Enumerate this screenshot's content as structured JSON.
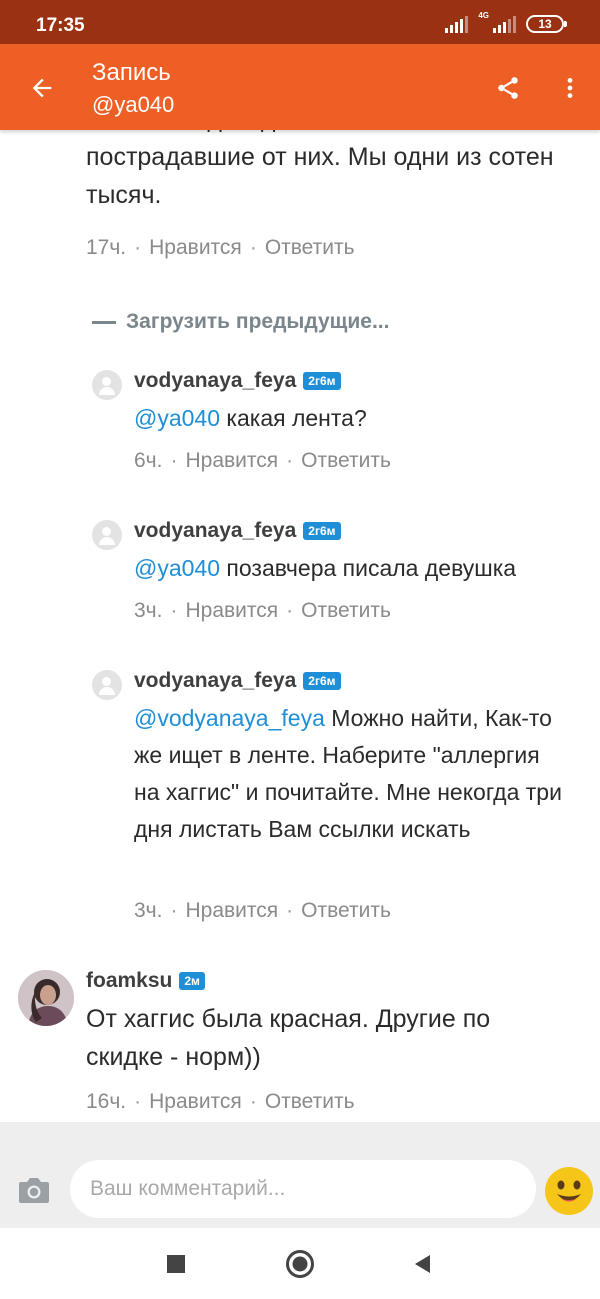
{
  "status_bar": {
    "time": "17:35",
    "network": "4G",
    "battery": "13"
  },
  "app_bar": {
    "title": "Запись",
    "subtitle": "@ya040",
    "accent": "#ee5f25"
  },
  "top_comment": {
    "text_line1": "злит... Каждый день в ленте есть",
    "text_rest": "пострадавшие от них. Мы одни из сотен тысяч.",
    "time": "17ч.",
    "like": "Нравится",
    "reply": "Ответить"
  },
  "load_previous": "Загрузить предыдущие...",
  "replies": [
    {
      "username": "vodyanaya_feya",
      "badge": "2г6м",
      "mention": "@ya040",
      "text": " какая лента?",
      "time": "6ч.",
      "like": "Нравится",
      "reply": "Ответить"
    },
    {
      "username": "vodyanaya_feya",
      "badge": "2г6м",
      "mention": "@ya040",
      "text": " позавчера писала девушка",
      "time": "3ч.",
      "like": "Нравится",
      "reply": "Ответить"
    },
    {
      "username": "vodyanaya_feya",
      "badge": "2г6м",
      "mention": "@vodyanaya_feya",
      "text": " Можно найти, Как-то же ищет в ленте. Наберите \"аллергия на хаггис\" и почитайте. Мне некогда три дня листать Вам ссылки искать",
      "time": "3ч.",
      "like": "Нравится",
      "reply": "Ответить"
    }
  ],
  "comment_foamksu": {
    "username": "foamksu",
    "badge": "2м",
    "text": "От хаггис была красная. Другие по скидке - норм))",
    "time": "16ч.",
    "like": "Нравится",
    "reply": "Ответить"
  },
  "input": {
    "placeholder": "Ваш комментарий..."
  },
  "colors": {
    "mention": "#1e8fd6",
    "badge": "#1e8fd6",
    "meta": "#8a8a8a"
  },
  "icons": [
    "back-arrow-icon",
    "share-icon",
    "more-vertical-icon",
    "camera-icon",
    "emoji-icon",
    "nav-recents-icon",
    "nav-home-icon",
    "nav-back-icon"
  ]
}
